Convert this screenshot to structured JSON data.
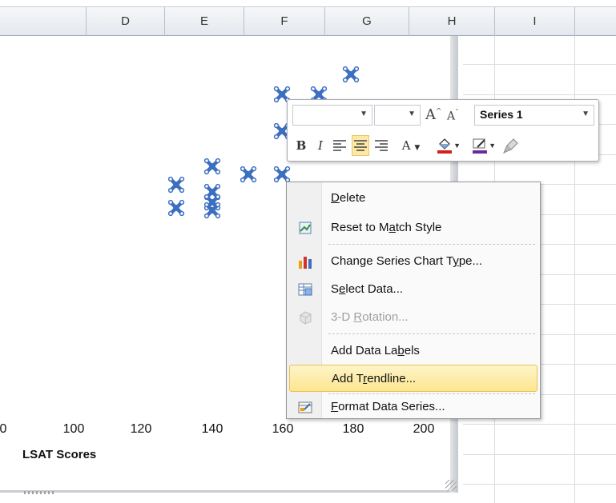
{
  "columns": [
    "D",
    "E",
    "F",
    "G",
    "H",
    "I"
  ],
  "chart": {
    "x_tick_labels": [
      "0",
      "100",
      "120",
      "140",
      "160",
      "180",
      "200"
    ],
    "x_axis_title": "LSAT Scores"
  },
  "mini_toolbar": {
    "series_selector_value": "Series 1",
    "bold_label": "B",
    "italic_label": "I",
    "font_color_label": "A",
    "grow_font_label": "A",
    "shrink_font_label": "A"
  },
  "context_menu": {
    "items": [
      {
        "label": "Delete",
        "mnemonic_index": 0,
        "icon": "none",
        "enabled": true
      },
      {
        "label": "Reset to Match Style",
        "mnemonic_index": 10,
        "icon": "reset-style-icon",
        "enabled": true
      },
      {
        "label": "Change Series Chart Type...",
        "mnemonic_index": 23,
        "icon": "chart-type-icon",
        "enabled": true
      },
      {
        "label": "Select Data...",
        "mnemonic_index": 1,
        "icon": "select-data-icon",
        "enabled": true
      },
      {
        "label": "3-D Rotation...",
        "mnemonic_index": 4,
        "icon": "rotation-3d-icon",
        "enabled": false
      },
      {
        "label": "Add Data Labels",
        "mnemonic_index": 11,
        "icon": "none",
        "enabled": true
      },
      {
        "label": "Add Trendline...",
        "mnemonic_index": 5,
        "icon": "none",
        "enabled": true,
        "highlighted": true
      },
      {
        "label": "Format Data Series...",
        "mnemonic_index": 0,
        "icon": "format-series-icon",
        "enabled": true
      }
    ]
  },
  "colors": {
    "marker_fill": "#3d6fc0",
    "highlight": "#fde68f",
    "font_color_red": "#d02020"
  }
}
